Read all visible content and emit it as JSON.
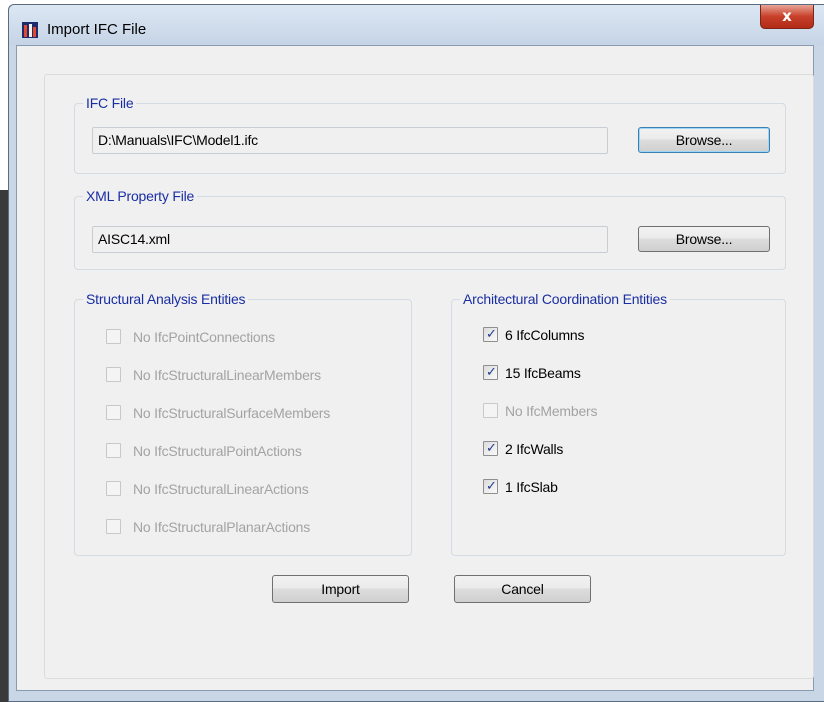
{
  "window": {
    "title": "Import IFC File",
    "close_symbol": "x"
  },
  "ifc_file": {
    "legend": "IFC File",
    "path": "D:\\Manuals\\IFC\\Model1.ifc",
    "browse_label": "Browse..."
  },
  "xml_file": {
    "legend": "XML Property File",
    "path": "AISC14.xml",
    "browse_label": "Browse..."
  },
  "structural": {
    "legend": "Structural Analysis Entities",
    "items": [
      {
        "label": "No IfcPointConnections",
        "checked": false,
        "enabled": false
      },
      {
        "label": "No IfcStructuralLinearMembers",
        "checked": false,
        "enabled": false
      },
      {
        "label": "No IfcStructuralSurfaceMembers",
        "checked": false,
        "enabled": false
      },
      {
        "label": "No IfcStructuralPointActions",
        "checked": false,
        "enabled": false
      },
      {
        "label": "No IfcStructuralLinearActions",
        "checked": false,
        "enabled": false
      },
      {
        "label": "No  IfcStructuralPlanarActions",
        "checked": false,
        "enabled": false
      }
    ]
  },
  "architectural": {
    "legend": "Architectural Coordination Entities",
    "items": [
      {
        "label": "6 IfcColumns",
        "checked": true,
        "enabled": true
      },
      {
        "label": "15 IfcBeams",
        "checked": true,
        "enabled": true
      },
      {
        "label": "No IfcMembers",
        "checked": false,
        "enabled": false
      },
      {
        "label": "2 IfcWalls",
        "checked": true,
        "enabled": true
      },
      {
        "label": "1 IfcSlab",
        "checked": true,
        "enabled": true
      }
    ]
  },
  "actions": {
    "import_label": "Import",
    "cancel_label": "Cancel"
  },
  "colors": {
    "legend_text": "#1a2ea3",
    "disabled_text": "#a3a3a3",
    "close_button": "#c7402a"
  }
}
